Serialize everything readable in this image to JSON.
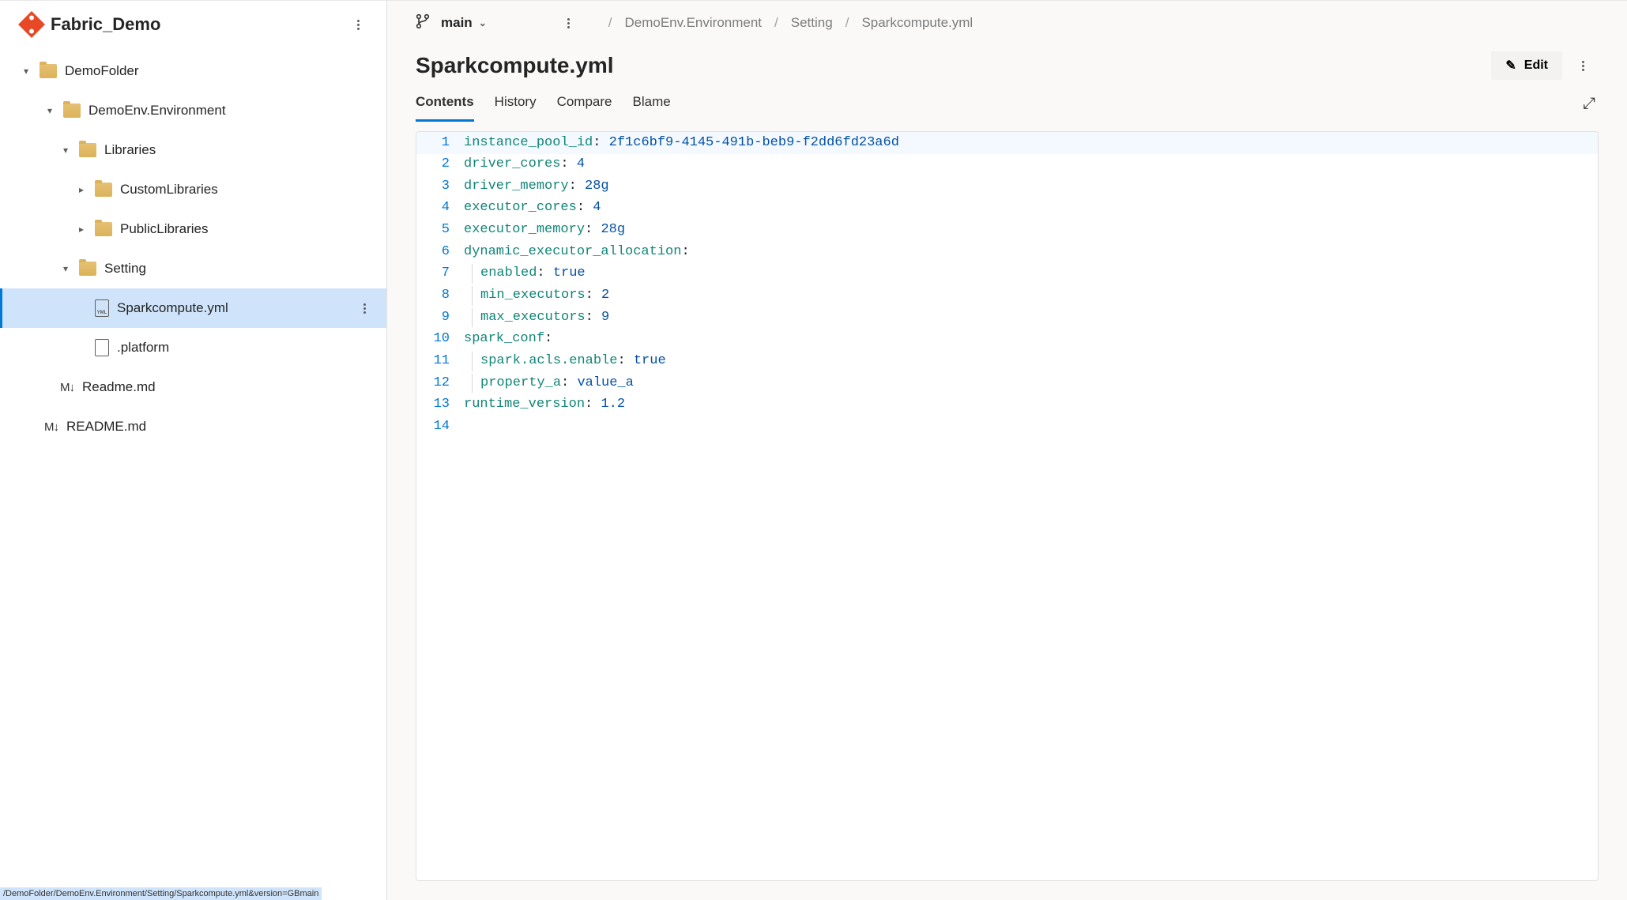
{
  "repo": {
    "name": "Fabric_Demo"
  },
  "tree": {
    "n0": "DemoFolder",
    "n1": "DemoEnv.Environment",
    "n2": "Libraries",
    "n3": "CustomLibraries",
    "n4": "PublicLibraries",
    "n5": "Setting",
    "n6": "Sparkcompute.yml",
    "n7": ".platform",
    "n8": "Readme.md",
    "n9": "README.md"
  },
  "branch": {
    "name": "main"
  },
  "breadcrumb": {
    "b0": "DemoEnv.Environment",
    "b1": "Setting",
    "b2": "Sparkcompute.yml"
  },
  "file": {
    "title": "Sparkcompute.yml"
  },
  "buttons": {
    "edit": "Edit"
  },
  "tabs": {
    "contents": "Contents",
    "history": "History",
    "compare": "Compare",
    "blame": "Blame"
  },
  "code": {
    "lines": [
      {
        "n": "1",
        "k": "instance_pool_id",
        "v": "2f1c6bf9-4145-491b-beb9-f2dd6fd23a6d",
        "indent": 0,
        "hl": true
      },
      {
        "n": "2",
        "k": "driver_cores",
        "v": "4",
        "indent": 0
      },
      {
        "n": "3",
        "k": "driver_memory",
        "v": "28g",
        "indent": 0
      },
      {
        "n": "4",
        "k": "executor_cores",
        "v": "4",
        "indent": 0
      },
      {
        "n": "5",
        "k": "executor_memory",
        "v": "28g",
        "indent": 0
      },
      {
        "n": "6",
        "k": "dynamic_executor_allocation",
        "v": "",
        "indent": 0
      },
      {
        "n": "7",
        "k": "enabled",
        "v": "true",
        "indent": 1
      },
      {
        "n": "8",
        "k": "min_executors",
        "v": "2",
        "indent": 1
      },
      {
        "n": "9",
        "k": "max_executors",
        "v": "9",
        "indent": 1
      },
      {
        "n": "10",
        "k": "spark_conf",
        "v": "",
        "indent": 0
      },
      {
        "n": "11",
        "k": "spark.acls.enable",
        "v": "true",
        "indent": 1
      },
      {
        "n": "12",
        "k": "property_a",
        "v": "value_a",
        "indent": 1
      },
      {
        "n": "13",
        "k": "runtime_version",
        "v": "1.2",
        "indent": 0
      },
      {
        "n": "14",
        "k": "",
        "v": "",
        "indent": 0
      }
    ]
  },
  "status": "/DemoFolder/DemoEnv.Environment/Setting/Sparkcompute.yml&version=GBmain"
}
